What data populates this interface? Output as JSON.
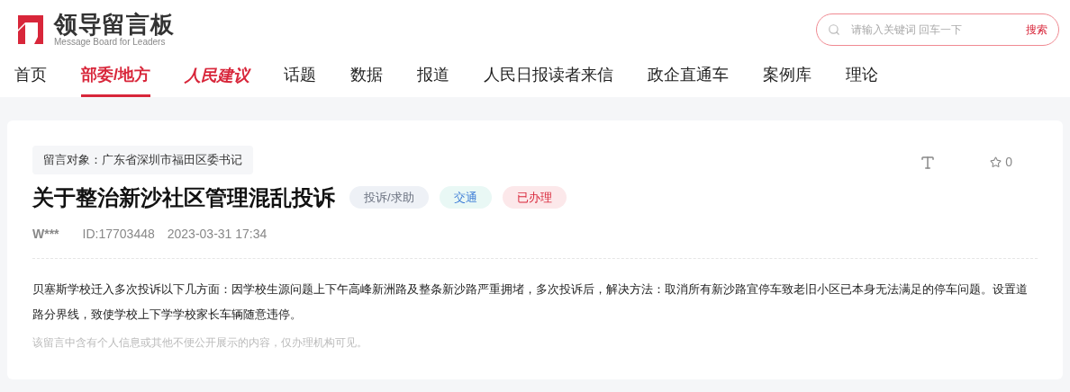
{
  "header": {
    "logo_title": "领导留言板",
    "logo_subtitle": "Message Board for Leaders",
    "search": {
      "placeholder": "请输入关键词 回车一下",
      "button": "搜索"
    }
  },
  "nav": [
    {
      "label": "首页",
      "selected": false,
      "kind": "text"
    },
    {
      "label": "部委/地方",
      "selected": true,
      "kind": "text"
    },
    {
      "label": "人民建议",
      "selected": false,
      "kind": "logo"
    },
    {
      "label": "话题",
      "selected": false,
      "kind": "text"
    },
    {
      "label": "数据",
      "selected": false,
      "kind": "text"
    },
    {
      "label": "报道",
      "selected": false,
      "kind": "text"
    },
    {
      "label": "人民日报读者来信",
      "selected": false,
      "kind": "text"
    },
    {
      "label": "政企直通车",
      "selected": false,
      "kind": "text"
    },
    {
      "label": "案例库",
      "selected": false,
      "kind": "text"
    },
    {
      "label": "理论",
      "selected": false,
      "kind": "text"
    }
  ],
  "message": {
    "recipient": "留言对象：广东省深圳市福田区委书记",
    "star_count": "0",
    "title": "关于整治新沙社区管理混乱投诉",
    "tags": [
      {
        "label": "投诉/求助",
        "kind": "type"
      },
      {
        "label": "交通",
        "kind": "category"
      },
      {
        "label": "已办理",
        "kind": "status"
      }
    ],
    "author": "W***",
    "id": "ID:17703448",
    "time": "2023-03-31 17:34",
    "body": "贝塞斯学校迁入多次投诉以下几方面：因学校生源问题上下午高峰新洲路及整条新沙路严重拥堵，多次投诉后，解决方法：取消所有新沙路宜停车致老旧小区已本身无法满足的停车问题。设置道路分界线，致使学校上下学学校家长车辆随意违停。",
    "notice": "该留言中含有个人信息或其他不便公开展示的内容，仅办理机构可见。"
  }
}
